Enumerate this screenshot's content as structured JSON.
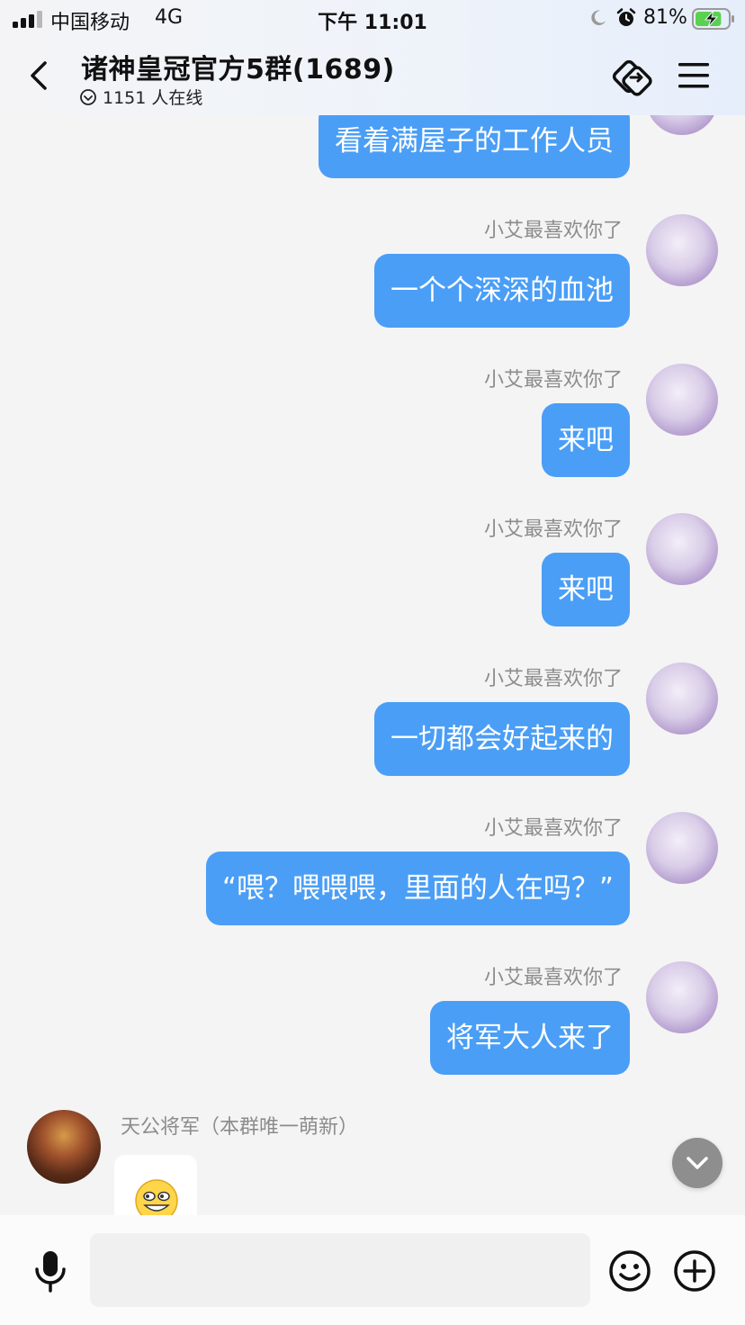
{
  "status_bar": {
    "carrier": "中国移动",
    "network": "4G",
    "time": "下午 11:01",
    "battery_percent": "81%",
    "battery_level": 0.81,
    "icons": [
      "signal-icon",
      "moon-icon",
      "alarm-icon",
      "battery-charging-icon"
    ]
  },
  "header": {
    "title": "诸神皇冠官方5群(1689)",
    "online": "1151 人在线"
  },
  "messages": [
    {
      "sender": "",
      "text": "看着满屋子的工作人员"
    },
    {
      "sender": "小艾最喜欢你了",
      "text": "一个个深深的血池"
    },
    {
      "sender": "小艾最喜欢你了",
      "text": "来吧"
    },
    {
      "sender": "小艾最喜欢你了",
      "text": "来吧"
    },
    {
      "sender": "小艾最喜欢你了",
      "text": "一切都会好起来的"
    },
    {
      "sender": "小艾最喜欢你了",
      "text": "“喂？喂喂喂，里面的人在吗？”"
    },
    {
      "sender": "小艾最喜欢你了",
      "text": "将军大人来了"
    }
  ],
  "incoming": {
    "sender": "天公将军（本群唯一萌新）",
    "sticker": "grinning-face-sticker"
  },
  "input": {
    "placeholder": ""
  },
  "colors": {
    "bubble_blue": "#4a9ef6",
    "background": "#f4f4f4",
    "name_gray": "#8c8c8c"
  }
}
